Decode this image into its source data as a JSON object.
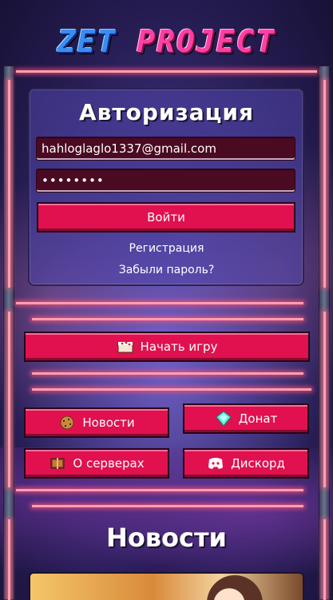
{
  "brand": {
    "logo_part1": "ZET",
    "logo_part2": "PROJECT"
  },
  "auth": {
    "title": "Авторизация",
    "email_value": "hahloglaglo1337@gmail.com",
    "password_value": "••••••••",
    "login_button": "Войти",
    "register_link": "Регистрация",
    "forgot_link": "Забыли пароль?"
  },
  "actions": {
    "start_game": {
      "label": "Начать игру",
      "icon": "cake-icon"
    },
    "news": {
      "label": "Новости",
      "icon": "cookie-icon"
    },
    "donate": {
      "label": "Донат",
      "icon": "diamond-icon"
    },
    "servers": {
      "label": "О серверах",
      "icon": "book-icon"
    },
    "discord": {
      "label": "Дискорд",
      "icon": "discord-icon"
    }
  },
  "news_section": {
    "title": "Новости"
  },
  "colors": {
    "button": "#e0114e",
    "field": "#4a0a22",
    "neon": "#ff9fae",
    "logo_blue": "#3a8cf0",
    "logo_pink": "#ff3fa4"
  }
}
